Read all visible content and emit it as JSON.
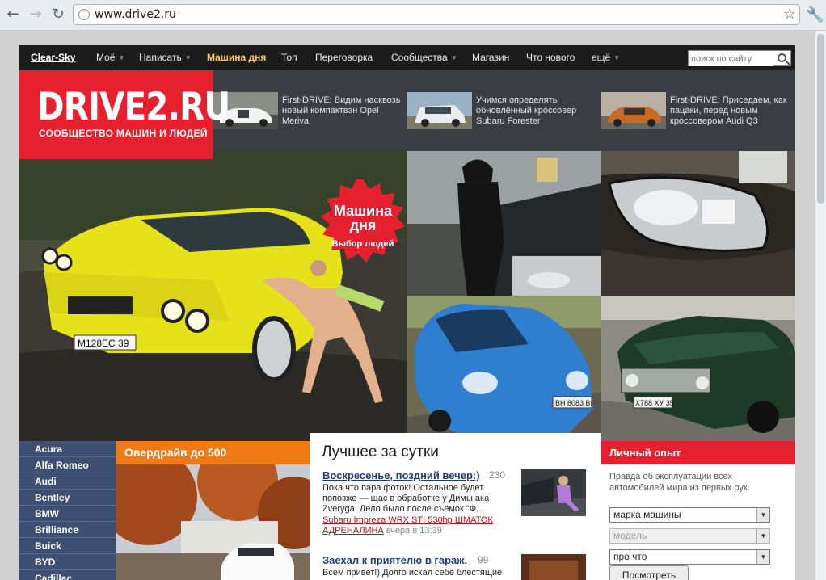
{
  "browser": {
    "url": "www.drive2.ru"
  },
  "topnav": {
    "user": "Clear-Sky",
    "items": [
      "Моё",
      "Написать",
      "Машина дня",
      "Топ",
      "Переговорка",
      "Сообщества",
      "Магазин",
      "Что нового",
      "ещё"
    ],
    "search_placeholder": "поиск по сайту"
  },
  "logo": {
    "name": "DRIVE2.RU",
    "tagline": "СООБЩЕСТВО МАШИН И ЛЮДЕЙ"
  },
  "news": [
    {
      "text": "First-DRIVE: Видим насквозь новый компактвэн Opel Meriva"
    },
    {
      "text": "Учимся определять обновлённый кроссовер Subaru Forester"
    },
    {
      "text": "First-DRIVE: Приседаем, как пацаки, перед новым кроссовером Audi Q3"
    }
  ],
  "car_of_day": {
    "title_line1": "Машина",
    "title_line2": "дня",
    "subtitle": "Выбор людей"
  },
  "plates": {
    "bmw": "М128ЕС 39",
    "toyota": "ВН 8083 ВІ",
    "lada": "Х788 ХУ 35"
  },
  "brands": [
    "Acura",
    "Alfa Romeo",
    "Audi",
    "Bentley",
    "BMW",
    "Brilliance",
    "Buick",
    "BYD",
    "Cadillac"
  ],
  "overdrive": {
    "title": "Овердрайв до 500"
  },
  "best": {
    "title": "Лучшее за сутки",
    "posts": [
      {
        "title": "Воскресенье, поздний вечер:)",
        "count": "230",
        "body": "Пока что пара фоток! Остальное будет попозже — щас в обработке у Димы ака Zveryga. Дело было после съёмок \"Ф...",
        "car": "Subaru Impreza WRX STI 530hp ШМАТОК АДРЕНАЛИНА",
        "time": "вчера в 13:39"
      },
      {
        "title": "Заехал к приятелю в гараж.",
        "count": "99",
        "body": "Всем привет!) Долго искал себе блестящие"
      }
    ]
  },
  "experience": {
    "title": "Личный опыт",
    "description": "Правда об эксплуатации всех автомобилей мира из первых рук.",
    "select_make": "марка машины",
    "select_model": "модель",
    "select_topic": "про что",
    "button": "Посмотреть"
  }
}
